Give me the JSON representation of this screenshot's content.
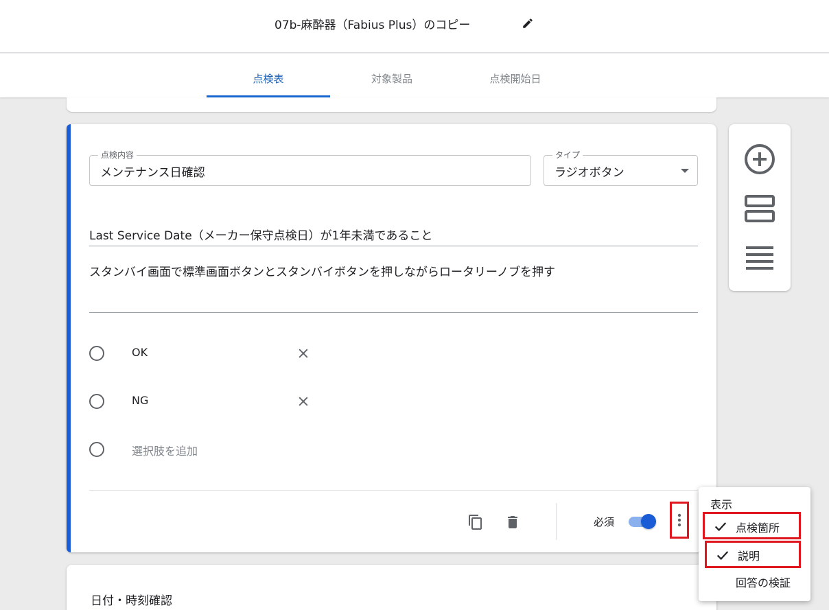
{
  "header": {
    "title": "07b-麻酔器（Fabius Plus）のコピー",
    "edit_icon": "pencil-icon"
  },
  "tabs": [
    {
      "label": "点検表",
      "active": true
    },
    {
      "label": "対象製品",
      "active": false
    },
    {
      "label": "点検開始日",
      "active": false
    }
  ],
  "question": {
    "content_label": "点検内容",
    "content_value": "メンテナンス日確認",
    "type_label": "タイプ",
    "type_value": "ラジオボタン",
    "location": "Last Service Date（メーカー保守点検日）が1年未満であること",
    "description": "スタンバイ画面で標準画面ボタンとスタンバイボタンを押しながらロータリーノブを押す",
    "options": [
      {
        "label": "OK"
      },
      {
        "label": "NG"
      }
    ],
    "add_option_placeholder": "選択肢を追加",
    "required_label": "必須",
    "required": true
  },
  "next_card": {
    "title": "日付・時刻確認"
  },
  "menu": {
    "heading": "表示",
    "items": [
      {
        "label": "点検箇所",
        "checked": true
      },
      {
        "label": "説明",
        "checked": true
      },
      {
        "label": "回答の検証",
        "checked": false
      }
    ]
  },
  "colors": {
    "accent": "#1a5cd6",
    "highlight_box": "#e0161e",
    "tab_active": "#1a5fb4"
  }
}
